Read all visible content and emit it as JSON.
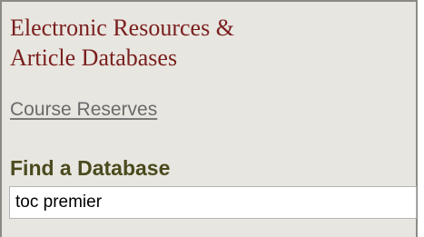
{
  "section": {
    "title_line1": "Electronic Resources &",
    "title_line2": "Article Databases"
  },
  "links": {
    "course_reserves": "Course Reserves"
  },
  "find_database": {
    "label": "Find a Database",
    "input_value": "toc premier"
  }
}
